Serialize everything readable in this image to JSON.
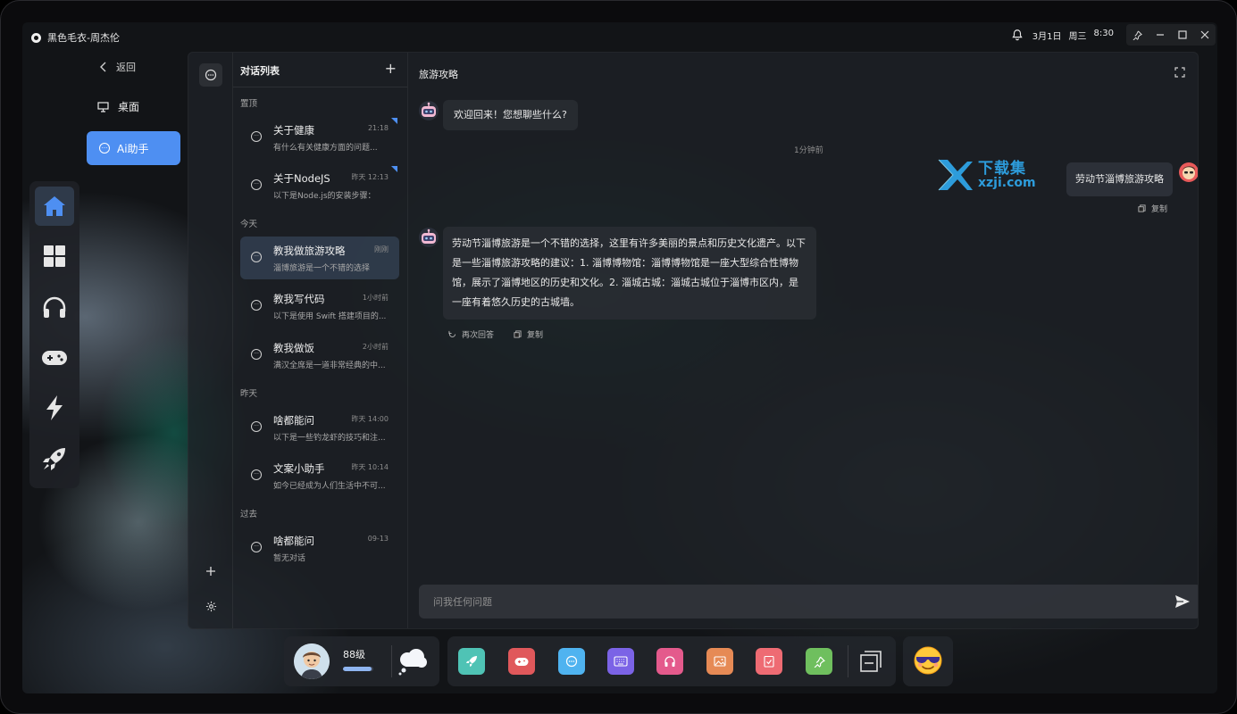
{
  "app": {
    "title": "黑色毛衣-周杰伦"
  },
  "status": {
    "date": "3月1日",
    "weekday": "周三",
    "time": "8:30"
  },
  "nav": {
    "back_label": "返回",
    "desktop_label": "桌面",
    "ai_label": "Ai助手",
    "dock_items": [
      "home-icon",
      "apps-grid-icon",
      "headphones-icon",
      "gamepad-icon",
      "lightning-icon",
      "rocket-icon"
    ]
  },
  "conversations": {
    "header": "对话列表",
    "sections": {
      "pinned": "置顶",
      "today": "今天",
      "yesterday": "昨天",
      "past": "过去"
    },
    "items": [
      {
        "title": "关于健康",
        "time": "21:18",
        "snippet": "有什么有关健康方面的问题...",
        "pinned": true
      },
      {
        "title": "关于NodeJS",
        "time": "昨天 12:13",
        "snippet": "以下是Node.js的安装步骤：",
        "pinned": true
      },
      {
        "title": "教我做旅游攻略",
        "time": "刚刚",
        "snippet": "淄博旅游是一个不错的选择",
        "active": true
      },
      {
        "title": "教我写代码",
        "time": "1小时前",
        "snippet": "以下是使用 Swift 搭建项目的..."
      },
      {
        "title": "教我做饭",
        "time": "2小时前",
        "snippet": "满汉全席是一道非常经典的中..."
      },
      {
        "title": "啥都能问",
        "time": "昨天 14:00",
        "snippet": "以下是一些钓龙虾的技巧和注..."
      },
      {
        "title": "文案小助手",
        "time": "昨天 10:14",
        "snippet": "如今已经成为人们生活中不可..."
      },
      {
        "title": "啥都能问",
        "time": "09-13",
        "snippet": "暂无对话"
      }
    ]
  },
  "chat": {
    "title": "旅游攻略",
    "welcome": "欢迎回来！您想聊些什么?",
    "timestamp": "1分钟前",
    "user_message": "劳动节淄博旅游攻略",
    "bot_reply": "劳动节淄博旅游是一个不错的选择，这里有许多美丽的景点和历史文化遗产。以下是一些淄博旅游攻略的建议：1. 淄博博物馆：淄博博物馆是一座大型综合性博物馆，展示了淄博地区的历史和文化。2. 淄城古城：淄城古城位于淄博市区内，是一座有着悠久历史的古城墙。",
    "copy_label": "复制",
    "regenerate_label": "再次回答",
    "input_placeholder": "问我任何问题"
  },
  "watermark": {
    "cn": "下载集",
    "en": "xzji.com"
  },
  "bottom_dock": {
    "level": "88级",
    "level_progress": 0.95,
    "apps": [
      {
        "icon": "rocket-icon",
        "color": "#4fc3b5"
      },
      {
        "icon": "gamepad-icon",
        "color": "#e0585b"
      },
      {
        "icon": "chat-icon",
        "color": "#4fb3f0"
      },
      {
        "icon": "keyboard-icon",
        "color": "#7b63e6"
      },
      {
        "icon": "headphones-icon",
        "color": "#e45a8c"
      },
      {
        "icon": "image-icon",
        "color": "#e68a55"
      },
      {
        "icon": "checklist-icon",
        "color": "#ee6b73"
      },
      {
        "icon": "pin-icon",
        "color": "#6fbf5e"
      }
    ]
  },
  "colors": {
    "accent": "#4e8ff2",
    "panel": "#1e2126"
  }
}
